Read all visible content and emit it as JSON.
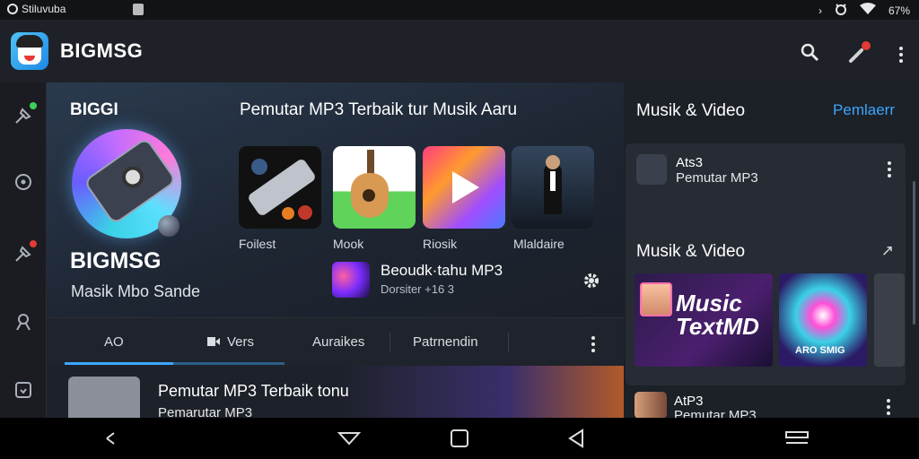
{
  "status": {
    "app_name": "Stiluvuba",
    "battery": "67%"
  },
  "appbar": {
    "title": "BIGMSG"
  },
  "hero": {
    "label": "BIGGI",
    "name": "BIGMSG",
    "subtitle": "Masik Mbo Sande",
    "headline": "Pemutar MP3 Terbaik tur Musik Aaru",
    "tiles": [
      {
        "label": "Foilest"
      },
      {
        "label": "Mook"
      },
      {
        "label": "Riosik"
      },
      {
        "label": "Mlaldaire"
      }
    ],
    "now_playing": {
      "title": "Beoudk·tahu MP3",
      "subtitle": "Dorsiter +16 3"
    }
  },
  "tabs": [
    {
      "label": "AO"
    },
    {
      "label": "Vers"
    },
    {
      "label": "Auraikes"
    },
    {
      "label": "Patrnendin"
    }
  ],
  "list_row": {
    "title": "Pemutar MP3 Terbaik tonu",
    "subtitle": "Pemarutar MP3"
  },
  "right_panel": {
    "heading": "Musik & Video",
    "link": "Pemlaerr",
    "card_item": {
      "title": "Ats3",
      "subtitle": "Pemutar MP3"
    },
    "section_heading": "Musik & Video",
    "trend_label": "↗",
    "poster1_text": "Music TextMD",
    "poster2_text": "ARO SMIG",
    "row_item": {
      "title": "AtP3",
      "subtitle": "Pemutar MP3"
    }
  },
  "colors": {
    "accent": "#3aa7ff",
    "background": "#15171c",
    "panel": "#1c2027"
  }
}
